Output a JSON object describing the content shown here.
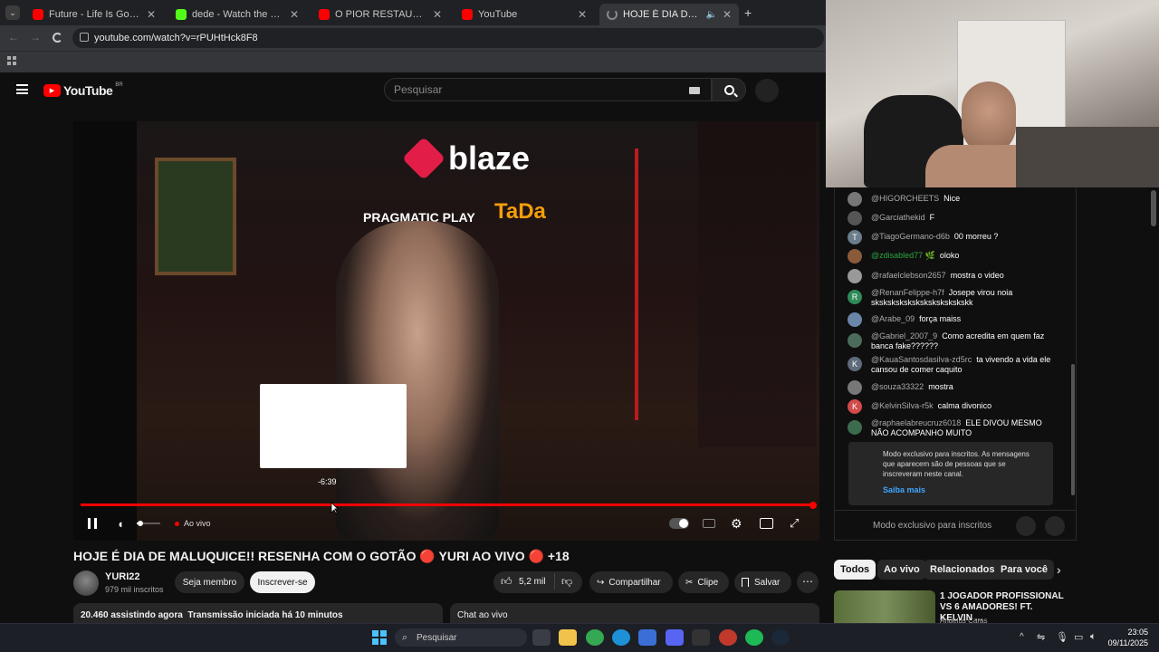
{
  "browser": {
    "tabs": [
      {
        "label": "Future - Life Is Good (Official M",
        "color": "#ff0000"
      },
      {
        "label": "dede - Watch the VOD on Kick",
        "color": "#53fc18"
      },
      {
        "label": "O PIOR RESTAURANTE DO MUI",
        "color": "#ff0000"
      },
      {
        "label": "YouTube",
        "color": "#ff0000"
      },
      {
        "label": "HOJE É DIA DE MALUQUICE",
        "color": "#888888"
      }
    ],
    "new_tab": "+",
    "url": "youtube.com/watch?v=rPUHtHck8F8"
  },
  "youtube": {
    "logo": "YouTube",
    "region": "BR",
    "search_placeholder": "Pesquisar"
  },
  "video": {
    "overlay_brand_1": "blaze",
    "overlay_brand_2": "PRAGMATIC PLAY",
    "overlay_brand_3": "TaDa",
    "hover_time": "-6:39",
    "live_label": "Ao vivo",
    "progress": 1.0,
    "volume": 0.05,
    "title": "HOJE É DIA DE MALUQUICE!! RESENHA COM O GOTÃO 🔴 YURI AO VIVO 🔴 +18"
  },
  "channel": {
    "name": "YURI22",
    "subs": "979 mil inscritos",
    "member_btn": "Seja membro",
    "subscribe_btn": "Inscrever-se"
  },
  "actions": {
    "likes": "5,2 mil",
    "share": "Compartilhar",
    "clip": "Clipe",
    "save": "Salvar"
  },
  "info": {
    "watching": "20.460 assistindo agora",
    "started": "Transmissão iniciada há 10 minutos",
    "chat_label": "Chat ao vivo"
  },
  "chat": {
    "messages": [
      {
        "author": "@HIGORCHEETS",
        "text": "Nice",
        "color": "#777777",
        "initial": ""
      },
      {
        "author": "@Garciathekid",
        "text": "F",
        "color": "#555555",
        "initial": ""
      },
      {
        "author": "@TiagoGermano-d6b",
        "text": "00 morreu ?",
        "color": "#6b7d8a",
        "initial": "T"
      },
      {
        "author": "@zdisabled77 🌿",
        "text": "oloko",
        "color": "#8a5a3a",
        "initial": ""
      },
      {
        "author": "@rafaelclebson2657",
        "text": "mostra o video",
        "color": "#999999",
        "initial": ""
      },
      {
        "author": "@RenanFelippe-h7f",
        "text": "Josepe virou noia skskskskskskskskskskskskk",
        "color": "#2e8b57",
        "initial": "R"
      },
      {
        "author": "@Arabe_09",
        "text": "força maiss",
        "color": "#6a86a8",
        "initial": ""
      },
      {
        "author": "@Gabriel_2007_9",
        "text": "Como acredita em quem faz banca fake??????",
        "color": "#4b6b5b",
        "initial": ""
      },
      {
        "author": "@KauaSantosdasilva-zd5rc",
        "text": "ta vivendo a vida ele cansou de comer caquito",
        "color": "#5f6b7a",
        "initial": "K"
      },
      {
        "author": "@souza33322",
        "text": "mostra",
        "color": "#777777",
        "initial": ""
      },
      {
        "author": "@KelvinSilva-r5k",
        "text": "calma divonico",
        "color": "#d34a4a",
        "initial": "K"
      },
      {
        "author": "@raphaelabreucruz6018",
        "text": "ELE DIVOU MESMO NÃO ACOMPANHO MUITO",
        "color": "#3d6b4e",
        "initial": ""
      }
    ],
    "notice": "Modo exclusivo para inscritos. As mensagens que aparecem são de pessoas que se inscreveram neste canal.",
    "learn_more": "Saiba mais",
    "input_placeholder": "Modo exclusivo para inscritos"
  },
  "related": {
    "chips": [
      "Todos",
      "Ao vivo",
      "Relacionados",
      "Para você"
    ],
    "first_title": "1 JOGADOR PROFISSIONAL VS 6 AMADORES! FT. KELVIN ...",
    "first_channel": "Angelus Caras"
  },
  "taskbar": {
    "search": "Pesquisar",
    "time": "23:05",
    "date": "09/11/2025"
  }
}
